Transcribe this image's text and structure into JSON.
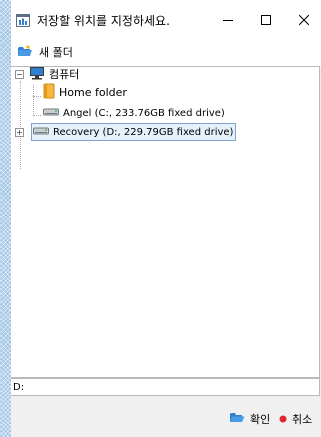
{
  "window": {
    "title": "저장할 위치를 지정하세요.",
    "minimize_glyph": "—",
    "maximize_glyph": "☐",
    "close_glyph": "✕"
  },
  "toolbar": {
    "new_folder_label": "새 폴더",
    "new_folder_icon": "new-folder-icon"
  },
  "tree": {
    "root": {
      "label": "컴퓨터",
      "expander": "−",
      "icon": "computer-icon"
    },
    "items": [
      {
        "label": "Home folder",
        "icon": "home-folder-icon"
      },
      {
        "label": "Angel (C:, 233.76GB fixed drive)",
        "icon": "drive-icon"
      },
      {
        "label": "Recovery (D:, 229.79GB fixed drive)",
        "icon": "drive-icon",
        "expander": "+",
        "selected": true
      }
    ]
  },
  "path": {
    "value": "D:"
  },
  "footer": {
    "ok_label": "확인",
    "cancel_label": "취소"
  },
  "colors": {
    "selection_border": "#7da2ce",
    "selection_fill": "#e5f1fb",
    "cancel_dot": "#e0282e",
    "folder": "#f5b93e"
  }
}
